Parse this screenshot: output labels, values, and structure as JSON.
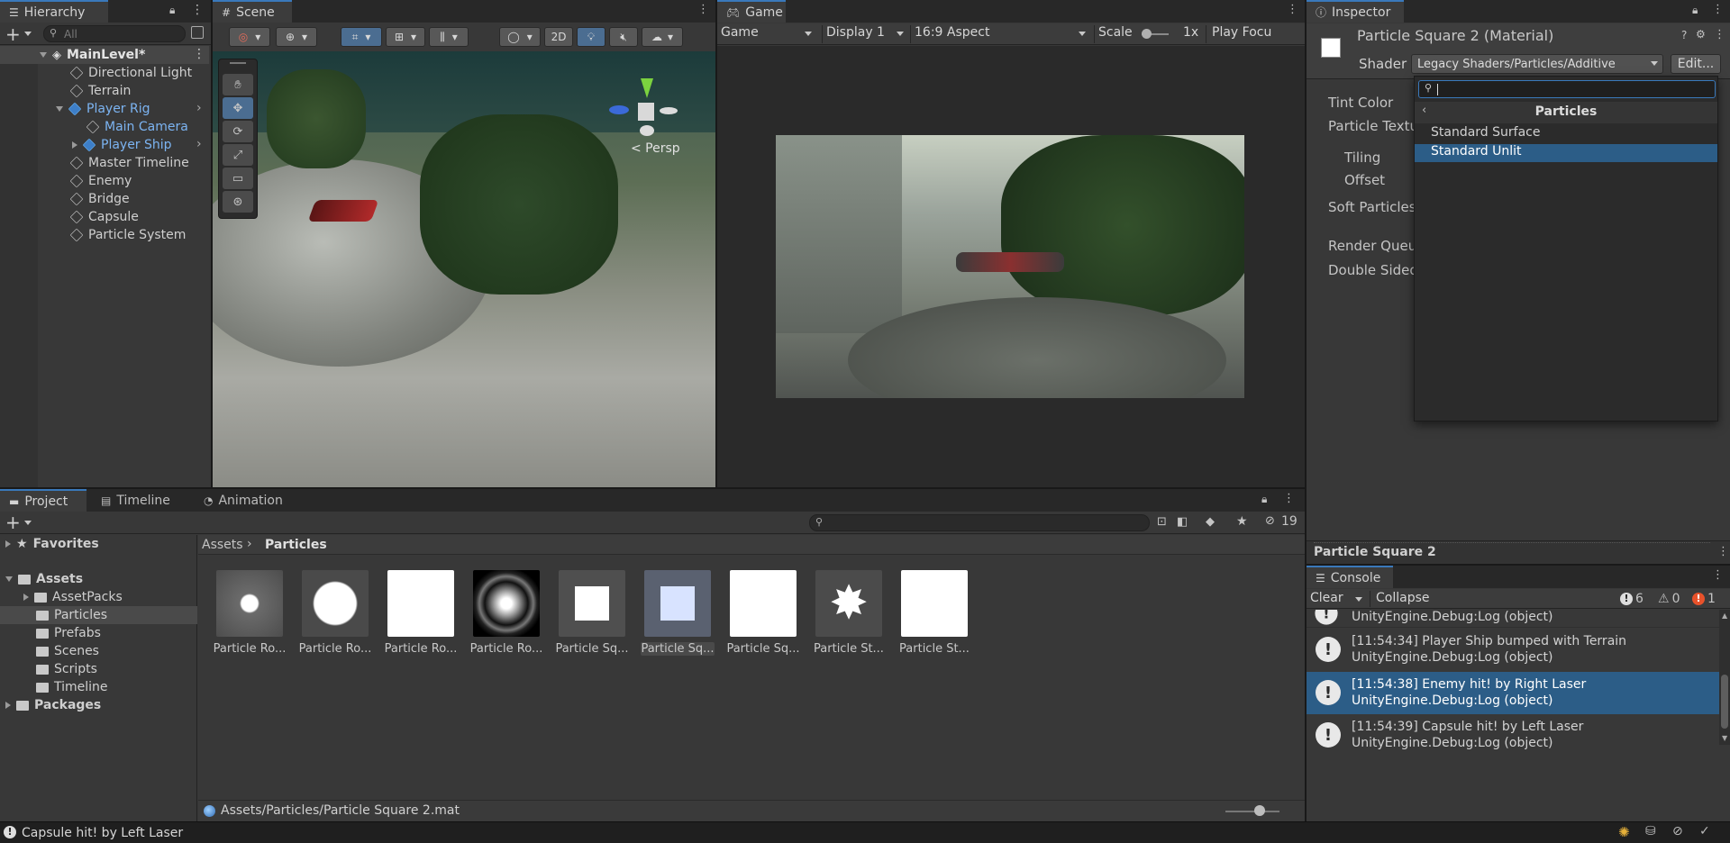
{
  "hierarchy": {
    "tab": "Hierarchy",
    "search_placeholder": "All",
    "items": [
      {
        "label": "MainLevel*"
      },
      {
        "label": "Directional Light"
      },
      {
        "label": "Terrain"
      },
      {
        "label": "Player Rig"
      },
      {
        "label": "Main Camera"
      },
      {
        "label": "Player Ship"
      },
      {
        "label": "Master Timeline"
      },
      {
        "label": "Enemy"
      },
      {
        "label": "Bridge"
      },
      {
        "label": "Capsule"
      },
      {
        "label": "Particle System"
      }
    ]
  },
  "scene": {
    "tab": "Scene",
    "btn_2d": "2D",
    "persp": "< Persp"
  },
  "game": {
    "tab": "Game",
    "mode": "Game",
    "display": "Display 1",
    "aspect": "16:9 Aspect",
    "scale_label": "Scale",
    "scale_value": "1x",
    "play_focus": "Play Focu"
  },
  "inspector": {
    "tab": "Inspector",
    "title": "Particle Square 2 (Material)",
    "shader_label": "Shader",
    "shader_value": "Legacy Shaders/Particles/Additive",
    "edit_button": "Edit...",
    "props": [
      "Tint Color",
      "Particle Textu",
      "Tiling",
      "Offset",
      "Soft Particles",
      "Render Queu",
      "Double Sided"
    ],
    "dropdown": {
      "header": "Particles",
      "items": [
        "Standard Surface",
        "Standard Unlit"
      ],
      "selected": "Standard Unlit"
    },
    "footer_name": "Particle Square 2"
  },
  "project": {
    "tabs": [
      "Project",
      "Timeline",
      "Animation"
    ],
    "count_badge": "19",
    "breadcrumb": [
      "Assets",
      "Particles"
    ],
    "tree": [
      {
        "label": "Favorites"
      },
      {
        "label": "Assets"
      },
      {
        "label": "AssetPacks"
      },
      {
        "label": "Particles"
      },
      {
        "label": "Prefabs"
      },
      {
        "label": "Scenes"
      },
      {
        "label": "Scripts"
      },
      {
        "label": "Timeline"
      },
      {
        "label": "Packages"
      }
    ],
    "assets": [
      {
        "label": "Particle Ro..."
      },
      {
        "label": "Particle Ro..."
      },
      {
        "label": "Particle Ro..."
      },
      {
        "label": "Particle Ro..."
      },
      {
        "label": "Particle Sq..."
      },
      {
        "label": "Particle Sq..."
      },
      {
        "label": "Particle Sq..."
      },
      {
        "label": "Particle St..."
      },
      {
        "label": "Particle St..."
      }
    ],
    "selected_path": "Assets/Particles/Particle Square 2.mat"
  },
  "console": {
    "tab": "Console",
    "clear": "Clear",
    "collapse": "Collapse",
    "count_info": "6",
    "count_warn": "0",
    "count_error": "1",
    "partial_line": "UnityEngine.Debug:Log (object)",
    "entries": [
      {
        "line1": "[11:54:34] Player Ship bumped with Terrain",
        "line2": "UnityEngine.Debug:Log (object)"
      },
      {
        "line1": "[11:54:38] Enemy hit! by Right Laser",
        "line2": "UnityEngine.Debug:Log (object)"
      },
      {
        "line1": "[11:54:39] Capsule hit! by Left Laser",
        "line2": "UnityEngine.Debug:Log (object)"
      }
    ]
  },
  "status_bar": {
    "message": "Capsule hit! by Left Laser"
  },
  "colors": {
    "accent": "#3a79bb",
    "selection": "#2c5d87",
    "prefab_blue": "#7cb4f2"
  }
}
